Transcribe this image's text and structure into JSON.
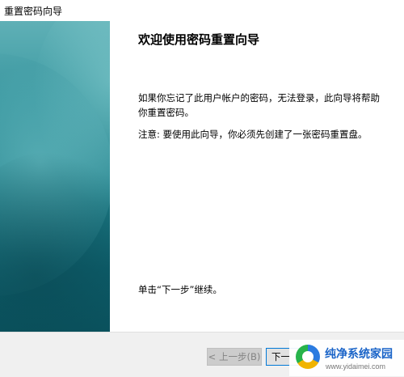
{
  "window": {
    "title": "重置密码向导"
  },
  "wizard": {
    "heading": "欢迎使用密码重置向导",
    "paragraph1": "如果你忘记了此用户帐户的密码，无法登录，此向导将帮助你重置密码。",
    "paragraph2": "注意: 要使用此向导，你必须先创建了一张密码重置盘。",
    "instruction": "单击“下一步”继续。"
  },
  "footer": {
    "back_label": "< 上一步(B)",
    "next_label": "下一"
  },
  "watermark": {
    "name": "纯净系统家园",
    "url": "www.yidaimei.com"
  },
  "colors": {
    "banner_top": "#5fb0b6",
    "banner_bottom": "#0a5460",
    "focus_border": "#0078d7",
    "footer_bg": "#f0f0f0"
  }
}
